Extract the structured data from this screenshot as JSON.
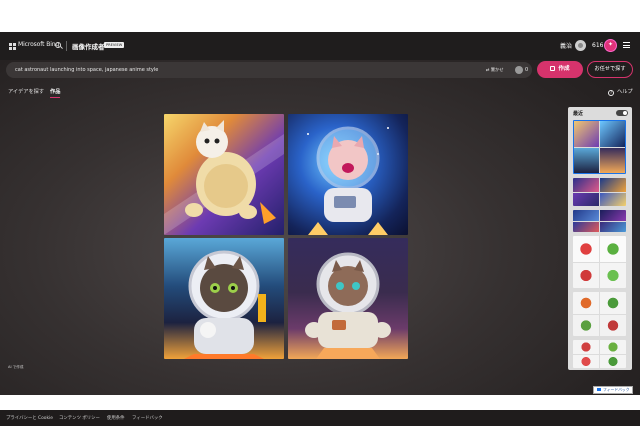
{
  "header": {
    "brand": "Microsoft Bing",
    "product": "画像作成者",
    "badge": "PREVIEW",
    "user_name": "義治",
    "points": "616"
  },
  "prompt": {
    "text": "cat astronaut launching into space, japanese anime style",
    "surprise_label": "驚かせ",
    "boost_count": "0"
  },
  "actions": {
    "create_label": "作成",
    "explore_label": "お任せで探す"
  },
  "tabs": [
    {
      "label": "アイデアを探す",
      "active": false
    },
    {
      "label": "作品",
      "active": true
    }
  ],
  "help_label": "ヘルプ",
  "made_with": "AI で作成",
  "side_panel": {
    "title": "最近"
  },
  "footer": {
    "links": [
      "プライバシーと Cookie",
      "コンテンツ ポリシー",
      "使用条件",
      "フィードバック"
    ],
    "feedback_button": "フィードバック"
  },
  "colors": {
    "accent": "#d6336c",
    "background": "#2c2828",
    "header_bg": "#1f1d1d"
  }
}
